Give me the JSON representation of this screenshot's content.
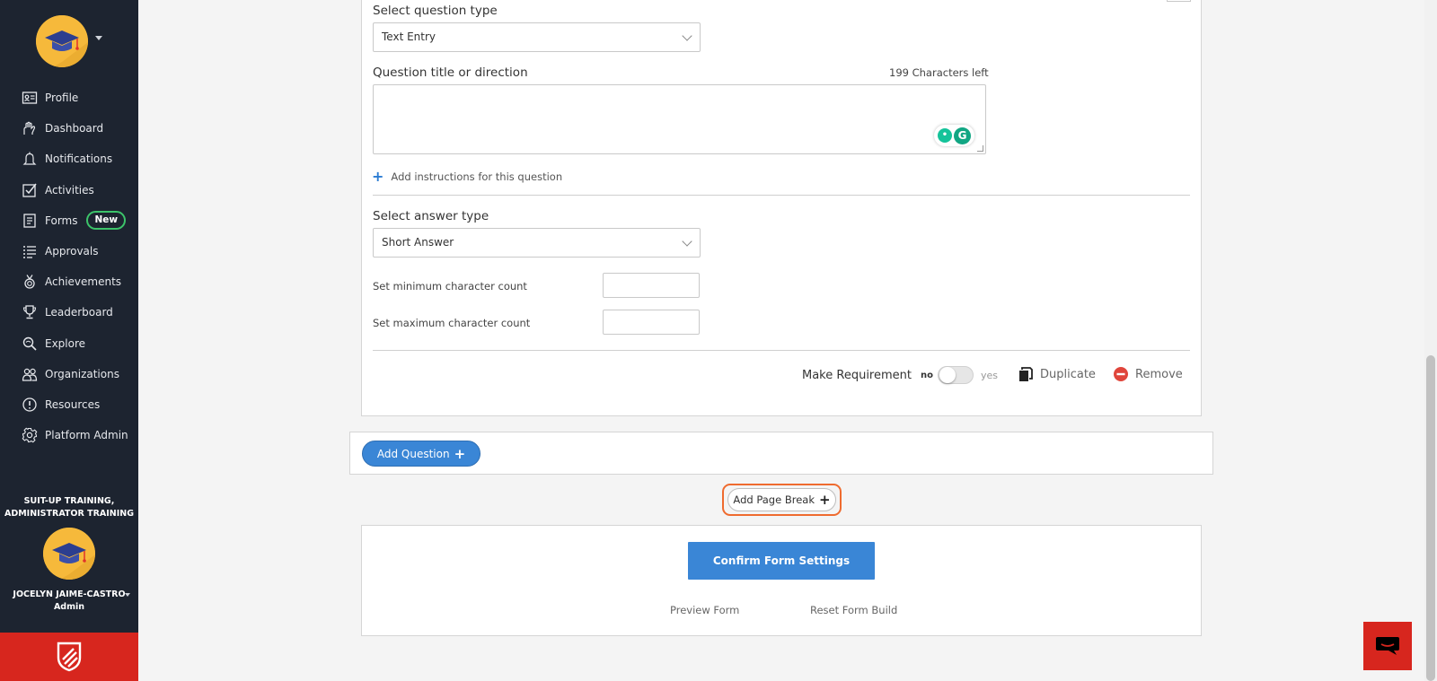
{
  "sidebar": {
    "nav": [
      {
        "label": "Profile",
        "icon": "profile-card-icon"
      },
      {
        "label": "Dashboard",
        "icon": "dashboard-hand-icon"
      },
      {
        "label": "Notifications",
        "icon": "bell-icon"
      },
      {
        "label": "Activities",
        "icon": "checkbox-icon"
      },
      {
        "label": "Forms",
        "icon": "form-icon",
        "badge": "New"
      },
      {
        "label": "Approvals",
        "icon": "list-check-icon"
      },
      {
        "label": "Achievements",
        "icon": "medal-icon"
      },
      {
        "label": "Leaderboard",
        "icon": "trophy-icon"
      },
      {
        "label": "Explore",
        "icon": "explore-icon"
      },
      {
        "label": "Organizations",
        "icon": "people-icon"
      },
      {
        "label": "Resources",
        "icon": "info-circle-icon"
      },
      {
        "label": "Platform Admin",
        "icon": "gear-icon"
      }
    ],
    "org_line1": "SUIT-UP TRAINING,",
    "org_line2": "ADMINISTRATOR TRAINING",
    "user_name": "JOCELYN JAIME-CASTRO",
    "user_role": "Admin",
    "brand_color": "#d7261e"
  },
  "question": {
    "type_label": "Select question type",
    "type_value": "Text Entry",
    "title_label": "Question title or direction",
    "chars_left": "199 Characters left",
    "title_value": "",
    "add_instructions": "Add instructions for this question",
    "answer_type_label": "Select answer type",
    "answer_type_value": "Short Answer",
    "min_count_label": "Set minimum character count",
    "max_count_label": "Set maximum character count",
    "make_requirement": "Make Requirement",
    "toggle_no": "no",
    "toggle_yes": "yes",
    "duplicate": "Duplicate",
    "remove": "Remove"
  },
  "actions": {
    "add_question": "Add Question",
    "add_page_break": "Add Page Break",
    "confirm": "Confirm Form Settings",
    "preview": "Preview Form",
    "reset": "Reset Form Build"
  },
  "colors": {
    "accent": "#3a86d6",
    "highlight": "#ef6b2f",
    "sidebar_bg": "#1d2430"
  }
}
